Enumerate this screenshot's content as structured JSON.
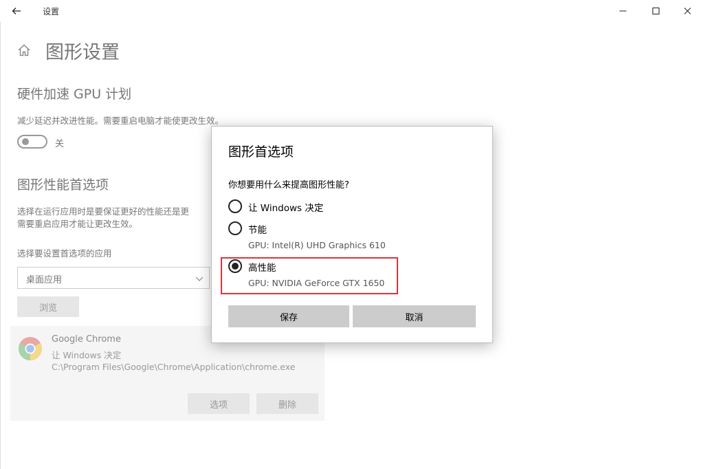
{
  "window": {
    "title": "设置"
  },
  "page": {
    "title": "图形设置"
  },
  "gpu_schedule": {
    "title": "硬件加速 GPU 计划",
    "description": "减少延迟并改进性能。需要重启电脑才能使更改生效。",
    "toggle_label": "关"
  },
  "perf_pref": {
    "title": "图形性能首选项",
    "description_line1": "选择在运行应用时是要保证更好的性能还是更",
    "description_line2": "需要重启应用才能让更改生效。",
    "select_label": "选择要设置首选项的应用",
    "select_value": "桌面应用",
    "browse_label": "浏览"
  },
  "app_entry": {
    "name": "Google Chrome",
    "preference": "让 Windows 决定",
    "path": "C:\\Program Files\\Google\\Chrome\\Application\\chrome.exe",
    "options_label": "选项",
    "delete_label": "删除"
  },
  "dialog": {
    "title": "图形首选项",
    "question": "你想要用什么来提高图形性能?",
    "options": [
      {
        "label": "让 Windows 决定",
        "sub": "",
        "checked": false
      },
      {
        "label": "节能",
        "sub": "GPU: Intel(R) UHD Graphics 610",
        "checked": false
      },
      {
        "label": "高性能",
        "sub": "GPU: NVIDIA GeForce GTX 1650",
        "checked": true
      }
    ],
    "save_label": "保存",
    "cancel_label": "取消"
  },
  "colors": {
    "highlight": "#e0333a",
    "dialog_button": "#cccccc"
  }
}
